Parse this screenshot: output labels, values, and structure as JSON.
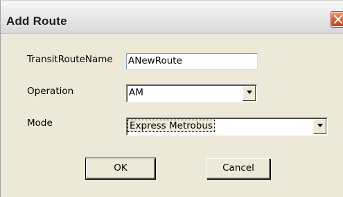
{
  "window": {
    "title": "Add Route"
  },
  "form": {
    "route_name_label": "TransitRouteName",
    "route_name_value": "ANewRoute",
    "operation_label": "Operation",
    "operation_value": "AM",
    "mode_label": "Mode",
    "mode_value": "Express Metrobus"
  },
  "buttons": {
    "ok_label": "OK",
    "cancel_label": "Cancel"
  },
  "icons": {
    "close": "close-icon",
    "dropdown": "chevron-down-icon"
  },
  "colors": {
    "close_button": "#e0603a",
    "dialog_background": "#ece9d8"
  }
}
